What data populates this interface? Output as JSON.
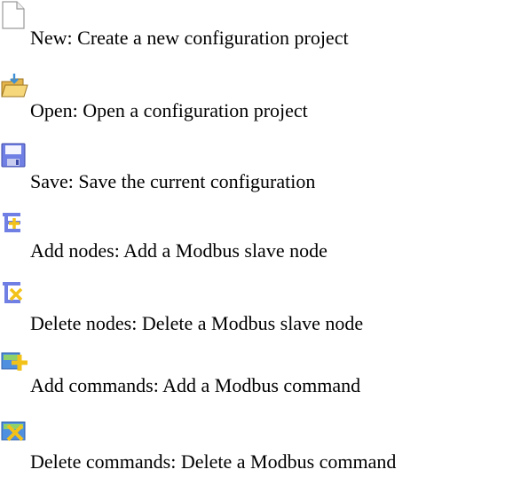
{
  "items": [
    {
      "icon": "new-document-icon",
      "text": "New: Create a new configuration project"
    },
    {
      "icon": "open-folder-icon",
      "text": "Open: Open a configuration project"
    },
    {
      "icon": "save-disk-icon",
      "text": "Save: Save the current configuration"
    },
    {
      "icon": "add-node-icon",
      "text": "Add nodes: Add a Modbus slave node"
    },
    {
      "icon": "delete-node-icon",
      "text": "Delete nodes: Delete a Modbus slave node"
    },
    {
      "icon": "add-command-icon",
      "text": "Add commands: Add a Modbus command"
    },
    {
      "icon": "delete-command-icon",
      "text": "Delete commands: Delete a Modbus command"
    }
  ],
  "colors": {
    "text": "#000000",
    "icon_blue": "#6f7fe3",
    "icon_yellow": "#f2c21a",
    "icon_green": "#4fa83a"
  }
}
